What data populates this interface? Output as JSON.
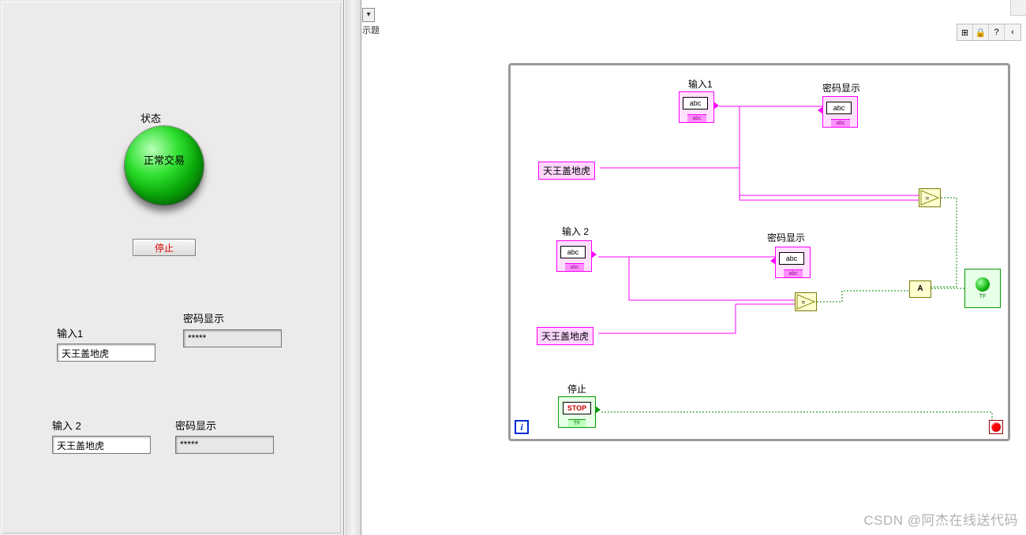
{
  "front_panel": {
    "state_label": "状态",
    "led_text": "正常交易",
    "stop_button": "停止",
    "input1_label": "输入1",
    "input1_value": "天王盖地虎",
    "input2_label": "输入 2",
    "input2_value": "天王盖地虎",
    "pw_label1": "密码显示",
    "pw_value1": "*****",
    "pw_label2": "密码显示",
    "pw_value2": "*****"
  },
  "splitter": {
    "dropdown_arrow": "▾",
    "cut_text": "示题"
  },
  "block_diagram": {
    "input1_node": "输入1",
    "input2_node": "输入 2",
    "pw1_node": "密码显示",
    "pw2_node": "密码显示",
    "const1": "天王盖地虎",
    "const2": "天王盖地虎",
    "stop_node": "停止",
    "abc": "abc",
    "abc_small": "abc",
    "stop_inner": "STOP",
    "tf": "TF",
    "iter": "i",
    "and_symbol": "A"
  },
  "toolbar": {
    "btn1": "⊞",
    "btn2": "🔒",
    "btn3": "?",
    "btn4": "‹"
  },
  "watermark": "CSDN @阿杰在线送代码"
}
